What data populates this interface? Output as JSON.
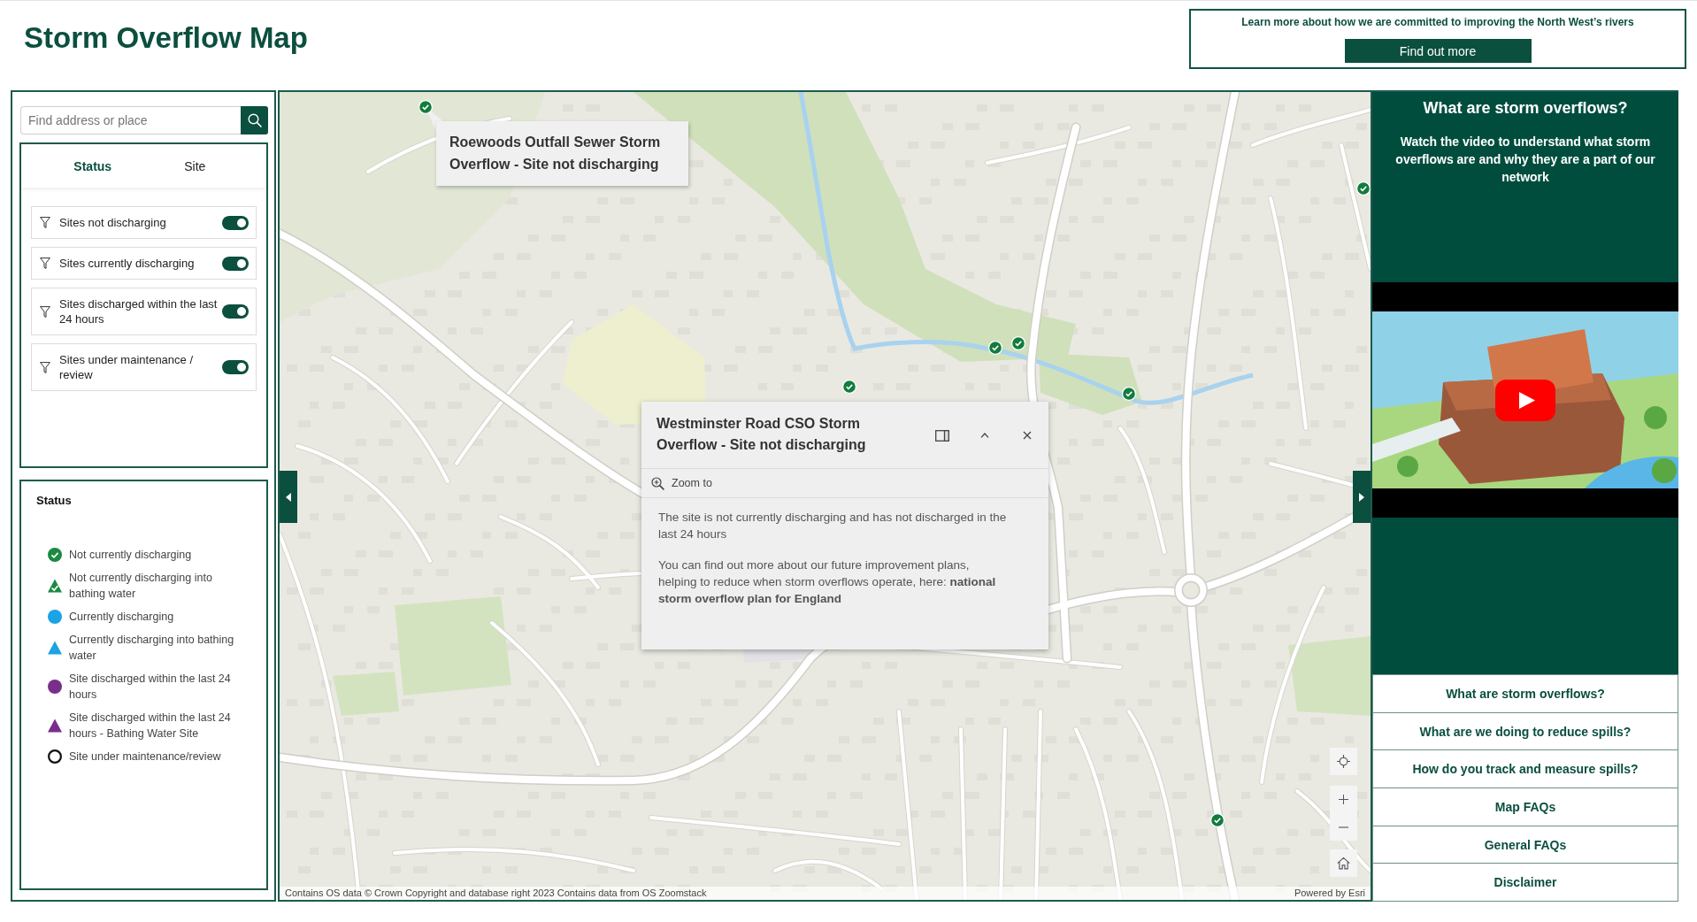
{
  "header": {
    "title": "Storm Overflow Map",
    "promo_text": "Learn more about how we are committed to improving the North West’s rivers",
    "promo_button": "Find out more"
  },
  "search": {
    "placeholder": "Find address or place"
  },
  "filter_tabs": [
    {
      "label": "Status",
      "selected": true
    },
    {
      "label": "Site",
      "selected": false
    }
  ],
  "filters": [
    {
      "label": "Sites not discharging",
      "on": true
    },
    {
      "label": "Sites currently discharging",
      "on": true
    },
    {
      "label": "Sites discharged within the last 24 hours",
      "on": true
    },
    {
      "label": "Sites under maintenance / review",
      "on": true
    }
  ],
  "legend": {
    "title": "Status",
    "items": [
      {
        "label": "Not currently discharging",
        "kind": "tickdot",
        "color": "#1a8a43"
      },
      {
        "label": "Not currently discharging into bathing water",
        "kind": "ticktriangle",
        "color": "#1a8a43"
      },
      {
        "label": "Currently discharging",
        "kind": "dot",
        "color": "#1ba3e3"
      },
      {
        "label": "Currently discharging into bathing water",
        "kind": "triangle",
        "color": "#1ba3e3"
      },
      {
        "label": "Site discharged within the last 24 hours",
        "kind": "dot",
        "color": "#7a2e8c"
      },
      {
        "label": "Site discharged within the last 24 hours - Bathing Water Site",
        "kind": "triangle",
        "color": "#7a2e8c"
      },
      {
        "label": "Site under maintenance/review",
        "kind": "ring",
        "color": "#111111"
      }
    ]
  },
  "map": {
    "markers": [
      {
        "kind": "tickdot"
      },
      {
        "kind": "tickdot"
      },
      {
        "kind": "tickdot"
      },
      {
        "kind": "tickdot"
      },
      {
        "kind": "tickdot"
      },
      {
        "kind": "tickdot"
      },
      {
        "kind": "tickdot"
      }
    ],
    "tooltip": "Roewoods Outfall Sewer Storm Overflow - Site not discharging",
    "popup": {
      "title": "Westminster Road CSO Storm Overflow - Site not discharging",
      "action": "Zoom to",
      "paragraphs": [
        "The site is not currently discharging and has not discharged in the last 24 hours",
        "You can find out more about our future improvement plans, helping to reduce when storm overflows operate, here: **national storm overflow plan for England**"
      ]
    },
    "attribution": "Contains OS data © Crown Copyright and database right 2023 Contains data from OS Zoomstack",
    "credit": "Powered by Esri"
  },
  "info_panel": {
    "title": "What are storm overflows?",
    "subtitle": "Watch the video to understand what storm overflows are and why they are a part of our network",
    "links": [
      "What are storm overflows?",
      "What are we doing to reduce spills?",
      "How do you track and measure spills?",
      "Map FAQs",
      "General FAQs",
      "Disclaimer"
    ]
  }
}
